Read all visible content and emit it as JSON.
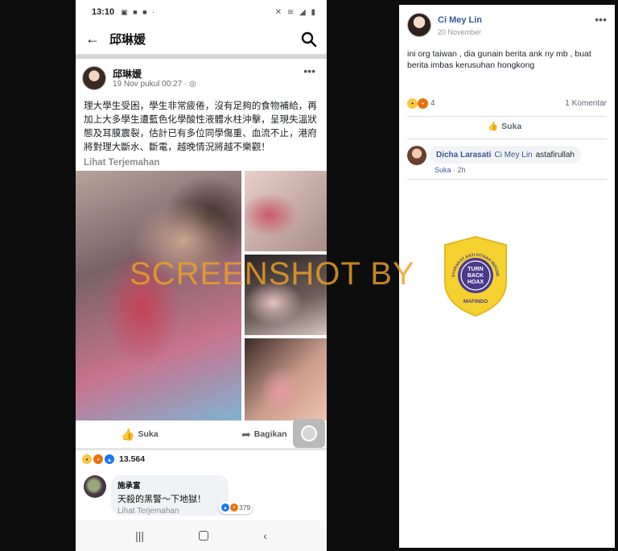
{
  "phone": {
    "status": {
      "time": "13:10",
      "left_icons": "▣ ■ ■ ·",
      "right_icons": "✕ ≋ ◢ ▮"
    },
    "appbar": {
      "back": "←",
      "title": "邱琳媛"
    },
    "post": {
      "author": "邱琳媛",
      "meta": "19 Nov pukul 00:27 · ◎",
      "more": "•••",
      "text": "理大學生受困，學生非常疲倦，沒有足夠的食物補給，再加上大多學生遭藍色化學酸性液體水柱沖擊，呈現失溫狀態及耳膜震裂，估計已有多位同學傷重、血流不止，港府將對理大斷水、斷電，越晚情況將越不樂觀！",
      "see_translation": "Lihat Terjemahan"
    },
    "actions": {
      "like_label": "Suka",
      "share_label": "Bagikan",
      "like_icon": "👍",
      "share_icon": "➦"
    },
    "reactions": {
      "count": "13.564",
      "types": [
        "sad",
        "angry",
        "like"
      ]
    },
    "comment": {
      "author": "施承富",
      "text": "天殺的黑警～下地獄！",
      "see_translation": "Lihat Terjemahan",
      "reaction_count": "379"
    },
    "navbar": {
      "recent": "|||",
      "back": "‹"
    }
  },
  "overlay": {
    "watermark": "SCREENSHOT BY",
    "badge": {
      "top_text": "MASYARAKAT ANTI FITNAH INDONESIA",
      "center_text_1": "TURN",
      "center_text_2": "BACK",
      "center_text_3": "HOAX",
      "bottom_text": "MAFINDO"
    }
  },
  "right_panel": {
    "author": "Ci Mey Lin",
    "date": "20 November",
    "more": "•••",
    "text": "ini org taiwan , dia gunain berita ank ny mb , buat berita imbas kerusuhan hongkong",
    "reaction_count": "4",
    "comments_label": "1 Komentar",
    "like_label": "Suka",
    "like_icon": "👍",
    "comment": {
      "author": "Dicha Larasati",
      "tag": "Ci Mey Lin",
      "text": "astafirullah",
      "like_link": "Suka",
      "dot": "·",
      "time": "2h"
    }
  },
  "colors": {
    "fb_blue": "#385898",
    "watermark_orange": "#eca028",
    "badge_yellow": "#f5d130",
    "badge_purple": "#4a3a8a"
  }
}
